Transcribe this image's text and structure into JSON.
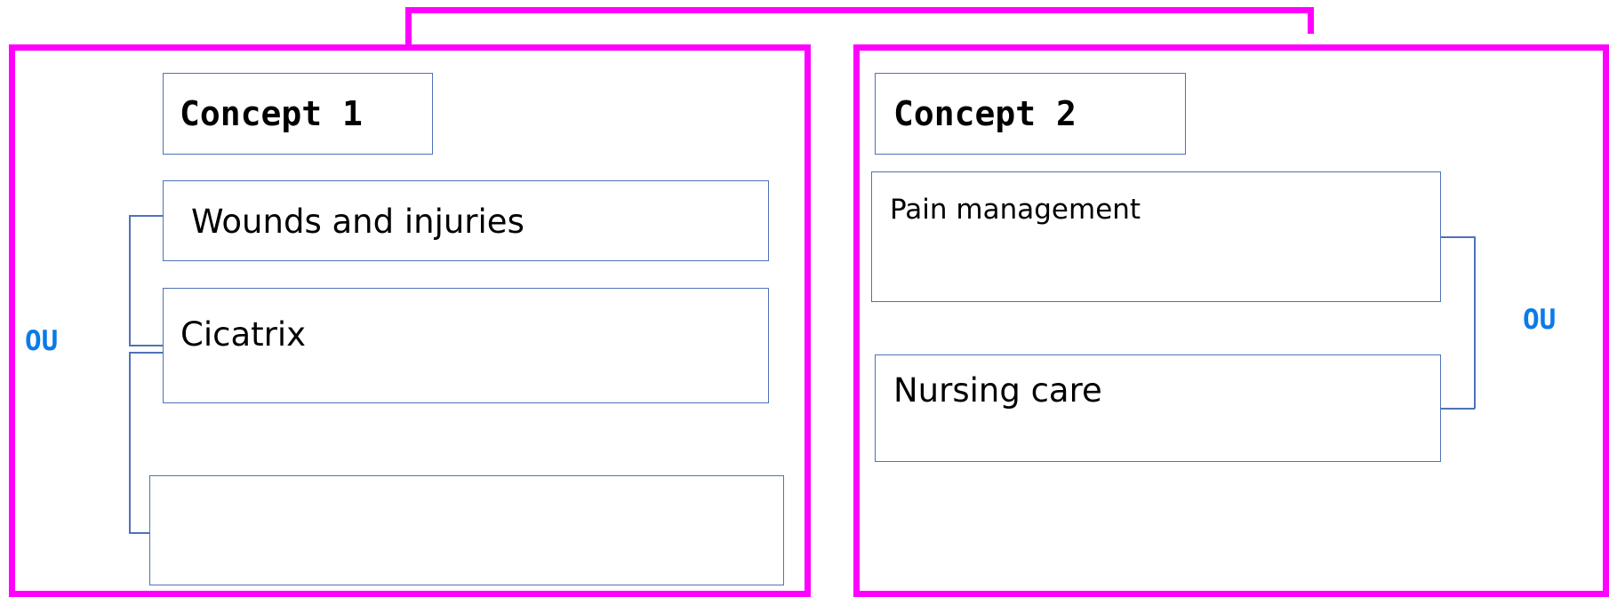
{
  "colors": {
    "frame": "#ff00ff",
    "box_border": "#4f72b8",
    "operator": "#0a7be8"
  },
  "concept1": {
    "title": "Concept 1",
    "terms": [
      "Wounds and injuries",
      "Cicatrix",
      ""
    ],
    "operator": "OU"
  },
  "concept2": {
    "title": "Concept 2",
    "terms": [
      "Pain management",
      "Nursing care"
    ],
    "operator": "OU"
  }
}
